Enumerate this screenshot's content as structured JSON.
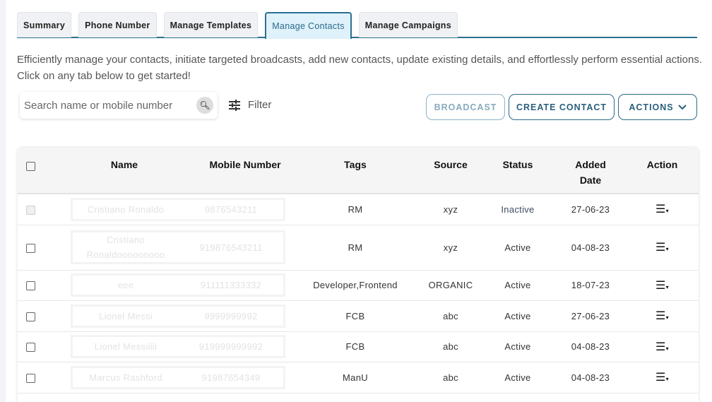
{
  "tabs": [
    "Summary",
    "Phone Number",
    "Manage Templates",
    "Manage Contacts",
    "Manage Campaigns"
  ],
  "active_tab": "Manage Contacts",
  "description": "Efficiently manage your contacts, initiate targeted broadcasts, add new contacts, update existing details, and effortlessly perform essential actions. Click on any tab below to get started!",
  "search": {
    "placeholder": "Search name or mobile number",
    "icon": "search-icon"
  },
  "filter_label": "Filter",
  "buttons": {
    "broadcast": "BROADCAST",
    "create": "CREATE CONTACT",
    "actions": "ACTIONS"
  },
  "colors": {
    "accent": "#2a7090",
    "active_tab_bg": "#dff1fa"
  },
  "table": {
    "headers": {
      "name": "Name",
      "mobile": "Mobile Number",
      "tags": "Tags",
      "source": "Source",
      "status": "Status",
      "added": "Added Date",
      "action": "Action"
    },
    "sort_indicator": "^",
    "rows": [
      {
        "name": "Cristiano Ronaldo",
        "mobile": "9876543211",
        "tags": "RM",
        "source": "xyz",
        "status": "Inactive",
        "added": "27-06-23"
      },
      {
        "name": "Cristiano Ronaldooooooooo",
        "mobile": "919876543211",
        "tags": "RM",
        "source": "xyz",
        "status": "Active",
        "added": "04-08-23"
      },
      {
        "name": "eee",
        "mobile": "911111333332",
        "tags": "Developer,Frontend",
        "source": "ORGANIC",
        "status": "Active",
        "added": "18-07-23"
      },
      {
        "name": "Lionel Messi",
        "mobile": "9999999992",
        "tags": "FCB",
        "source": "abc",
        "status": "Active",
        "added": "27-06-23"
      },
      {
        "name": "Lionel Messiiiii",
        "mobile": "919999999992",
        "tags": "FCB",
        "source": "abc",
        "status": "Active",
        "added": "04-08-23"
      },
      {
        "name": "Marcus Rashford",
        "mobile": "91987654349",
        "tags": "ManU",
        "source": "abc",
        "status": "Active",
        "added": "04-08-23"
      }
    ]
  }
}
